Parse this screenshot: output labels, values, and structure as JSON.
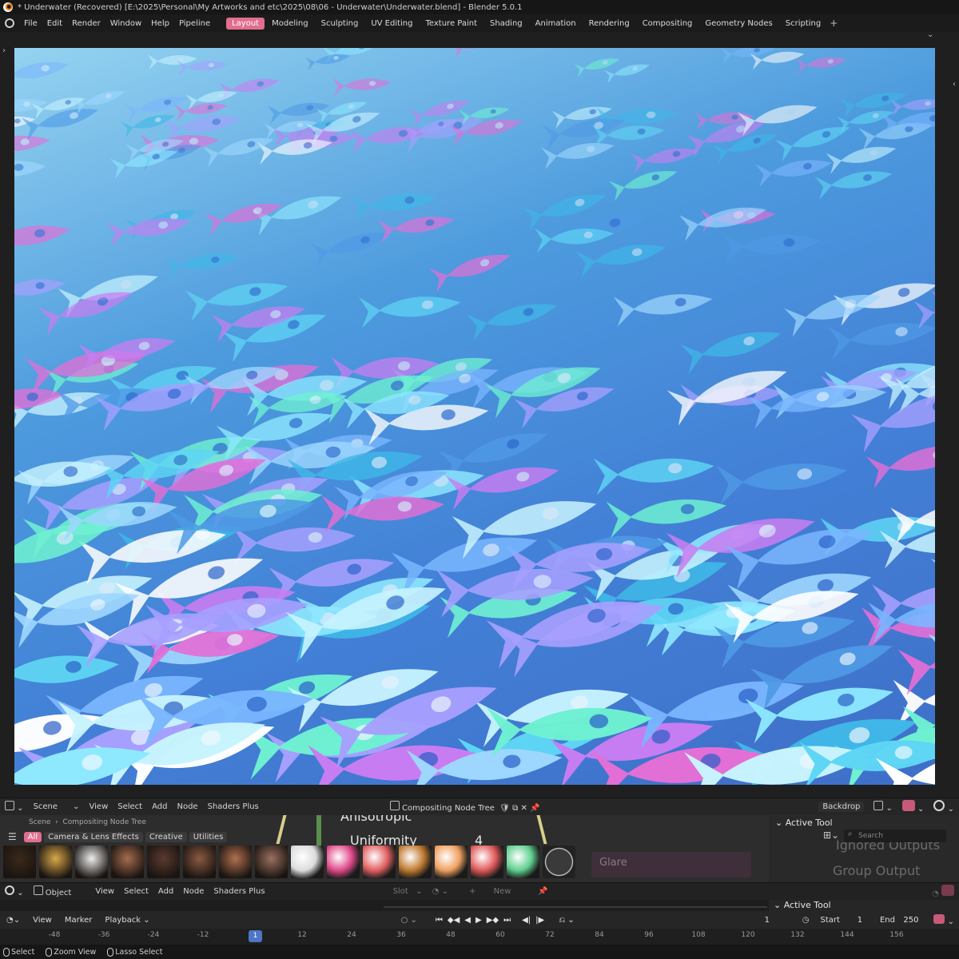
{
  "window": {
    "title": "* Underwater (Recovered) [E:\\2025\\Personal\\My Artworks and etc\\2025\\08\\06 - Underwater\\Underwater.blend] - Blender 5.0.1"
  },
  "menu": {
    "items": [
      "File",
      "Edit",
      "Render",
      "Window",
      "Help",
      "Pipeline"
    ],
    "workspaces": [
      "Layout",
      "Modeling",
      "Sculpting",
      "UV Editing",
      "Texture Paint",
      "Shading",
      "Animation",
      "Rendering",
      "Compositing",
      "Geometry Nodes",
      "Scripting"
    ],
    "active_workspace": "Layout",
    "add_workspace": "+"
  },
  "compositor_header": {
    "scene": "Scene",
    "menus": [
      "View",
      "Select",
      "Add",
      "Node",
      "Shaders Plus"
    ],
    "node_tree": "Compositing Node Tree",
    "backdrop": "Backdrop"
  },
  "node_editor": {
    "bg_labels": [
      "Anisotropic",
      "Uniformity",
      "4"
    ],
    "breadcrumb": [
      "Scene",
      "Compositing Node Tree"
    ],
    "asset_tabs": [
      "All",
      "Camera & Lens Effects",
      "Creative",
      "Utilities"
    ],
    "active_tab": "All",
    "side_panel_title": "Active Tool",
    "search_placeholder": "Search",
    "ghost_items": [
      "Ignored Outputs",
      "Group Output"
    ],
    "glare_label": "Glare",
    "thumb_colors": [
      "#3a2a1a",
      "#d9a84a",
      "#eeeeee",
      "#a66c4e",
      "#5a3a30",
      "#8a5a42",
      "#b07050",
      "#9a7060",
      "#dcdcdc",
      "#e04a8a",
      "#e06060",
      "#c07a30",
      "#f0a060",
      "#e05a5a",
      "#60d090",
      "#2a2a2a"
    ]
  },
  "object_header": {
    "mode": "Object",
    "menus": [
      "View",
      "Select",
      "Add",
      "Node",
      "Shaders Plus"
    ],
    "slot": "Slot",
    "new": "New",
    "side_panel_title": "Active Tool"
  },
  "timeline_header": {
    "menus": [
      "View",
      "Marker",
      "Playback"
    ],
    "current_frame": "1",
    "start_label": "Start",
    "start": "1",
    "end_label": "End",
    "end": "250"
  },
  "ruler": {
    "ticks": [
      "-48",
      "-36",
      "-24",
      "-12",
      "12",
      "24",
      "36",
      "48",
      "60",
      "72",
      "84",
      "96",
      "108",
      "120",
      "132",
      "144",
      "156"
    ],
    "current": "1"
  },
  "statusbar": {
    "items": [
      "Select",
      "Zoom View",
      "Lasso Select"
    ]
  }
}
